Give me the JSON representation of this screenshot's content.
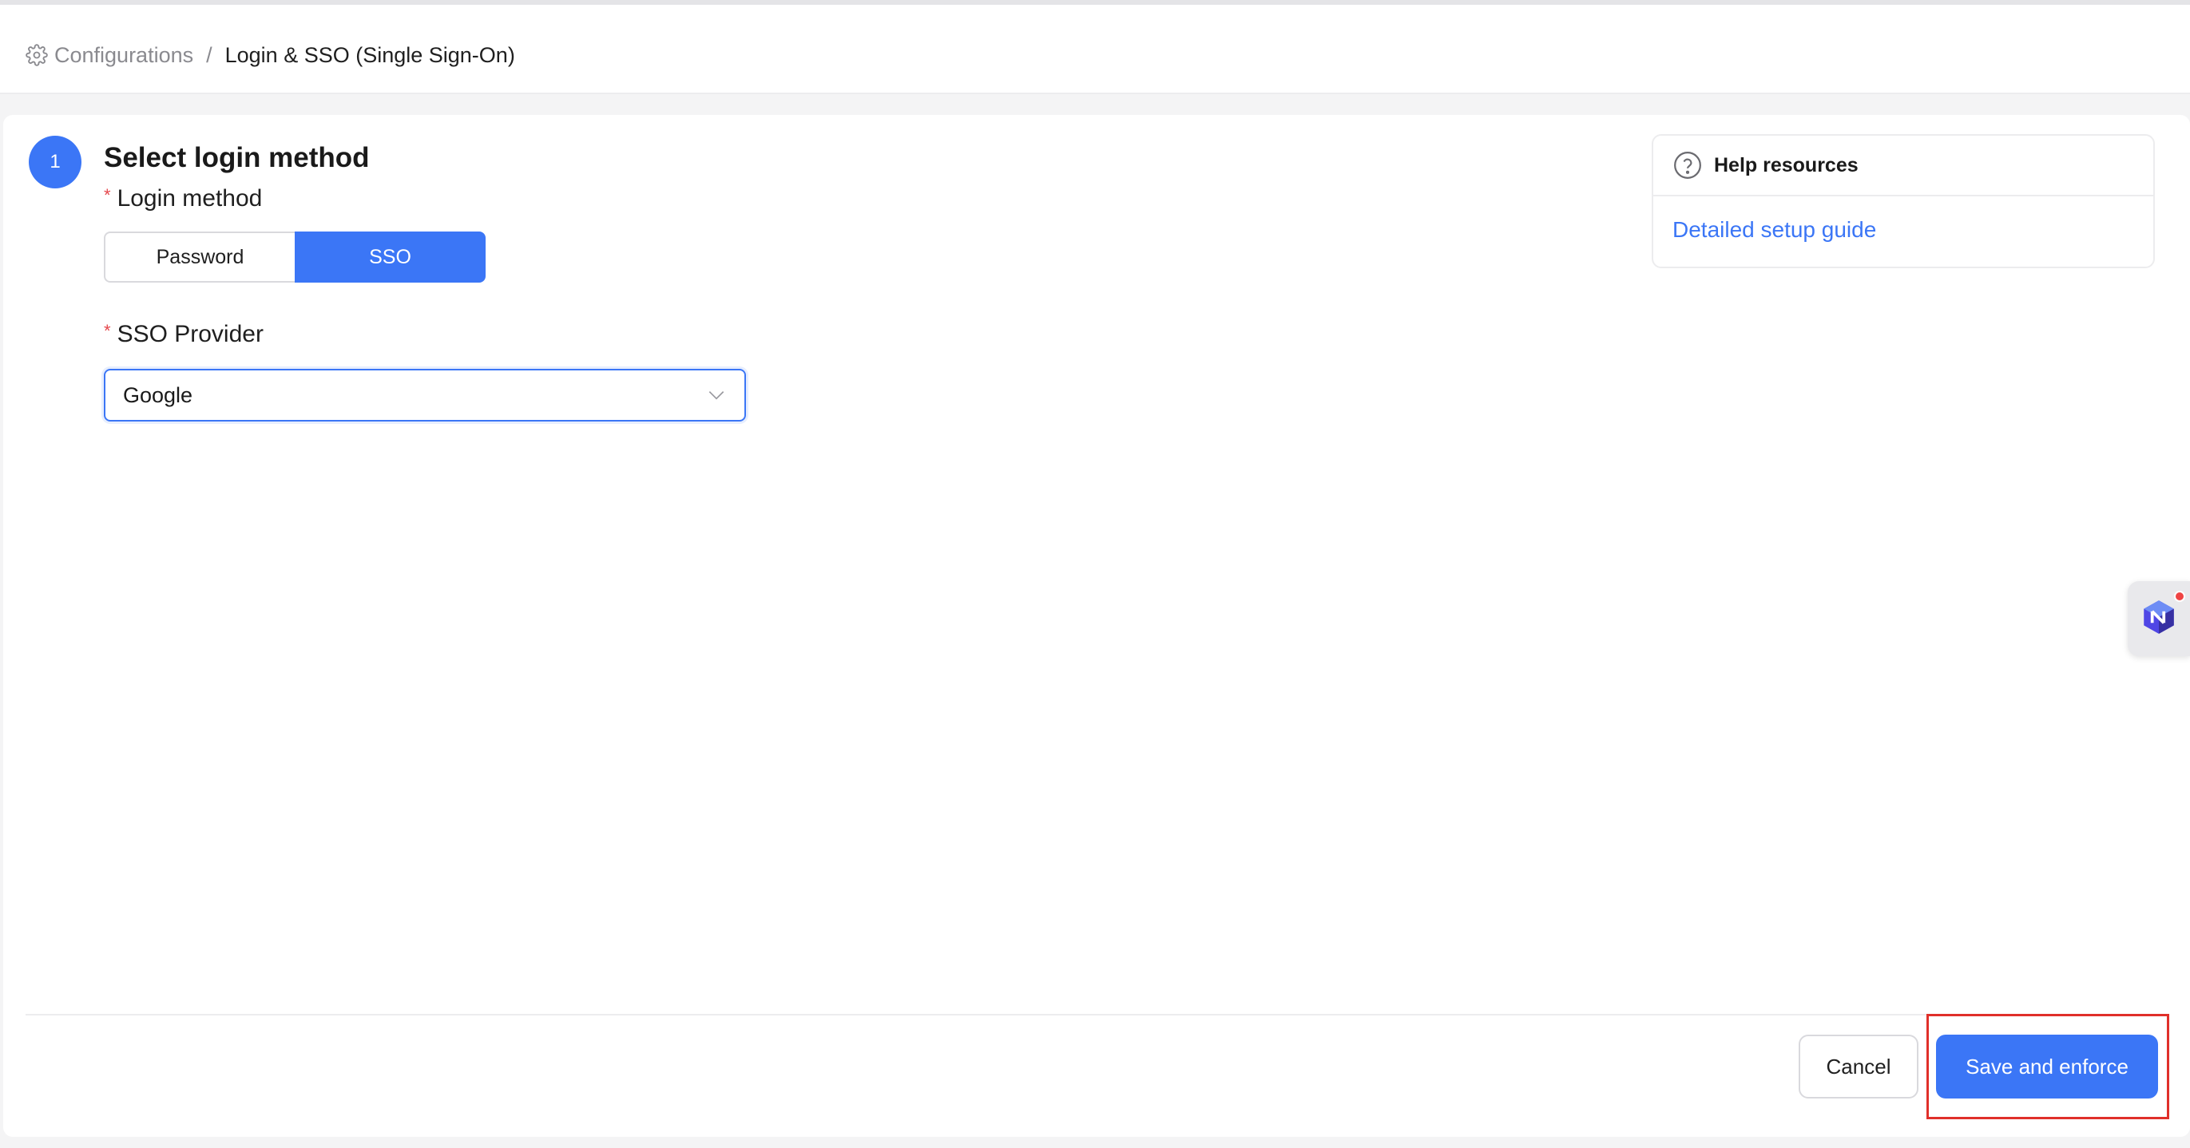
{
  "breadcrumb": {
    "parent": "Configurations",
    "separator": "/",
    "current": "Login & SSO (Single Sign-On)"
  },
  "step": {
    "number": "1",
    "title": "Select login method"
  },
  "login_method": {
    "label": "Login method",
    "required_mark": "*",
    "options": [
      "Password",
      "SSO"
    ],
    "selected": "SSO"
  },
  "sso_provider": {
    "label": "SSO Provider",
    "required_mark": "*",
    "value": "Google"
  },
  "help": {
    "title": "Help resources",
    "link_label": "Detailed setup guide"
  },
  "footer": {
    "cancel_label": "Cancel",
    "save_label": "Save and enforce"
  },
  "colors": {
    "accent": "#3b76f6",
    "required": "#e5484d",
    "highlight": "#e0302a"
  }
}
